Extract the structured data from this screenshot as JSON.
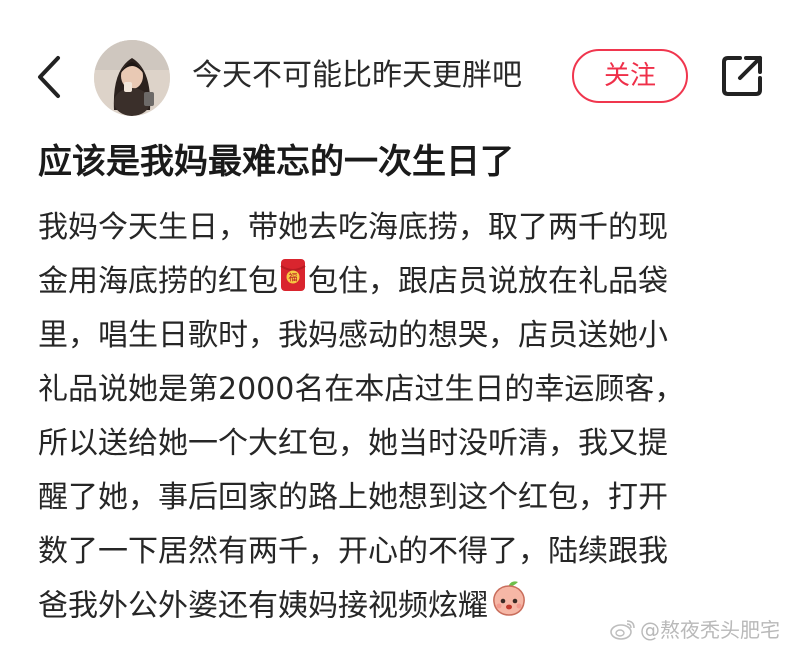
{
  "header": {
    "username": "今天不可能比昨天更胖吧",
    "follow_label": "关注"
  },
  "post": {
    "title": "应该是我妈最难忘的一次生日了",
    "lines": [
      "我妈今天生日，带她去吃海底捞，取了两千的现",
      "金用海底捞的红包",
      "包住，跟店员说放在礼品袋",
      "里，唱生日歌时，我妈感动的想哭，店员送她小",
      "礼品说她是第2000名在本店过生日的幸运顾客，",
      "所以送给她一个大红包，她当时没听清，我又提",
      "醒了她，事后回家的路上她想到这个红包，打开",
      "数了一下居然有两千，开心的不得了，陆续跟我",
      "爸我外公外婆还有姨妈接视频炫耀"
    ]
  },
  "icons": {
    "back": "chevron-left-icon",
    "share": "share-external-icon",
    "red_envelope": "red-envelope-emoji",
    "peach": "peach-emoji",
    "red_envelope_glyph": "福"
  },
  "watermark": {
    "text": "@熬夜秃头肥宅"
  },
  "colors": {
    "accent": "#ef2f49",
    "text": "#262626",
    "watermark": "#b9b9b9"
  }
}
